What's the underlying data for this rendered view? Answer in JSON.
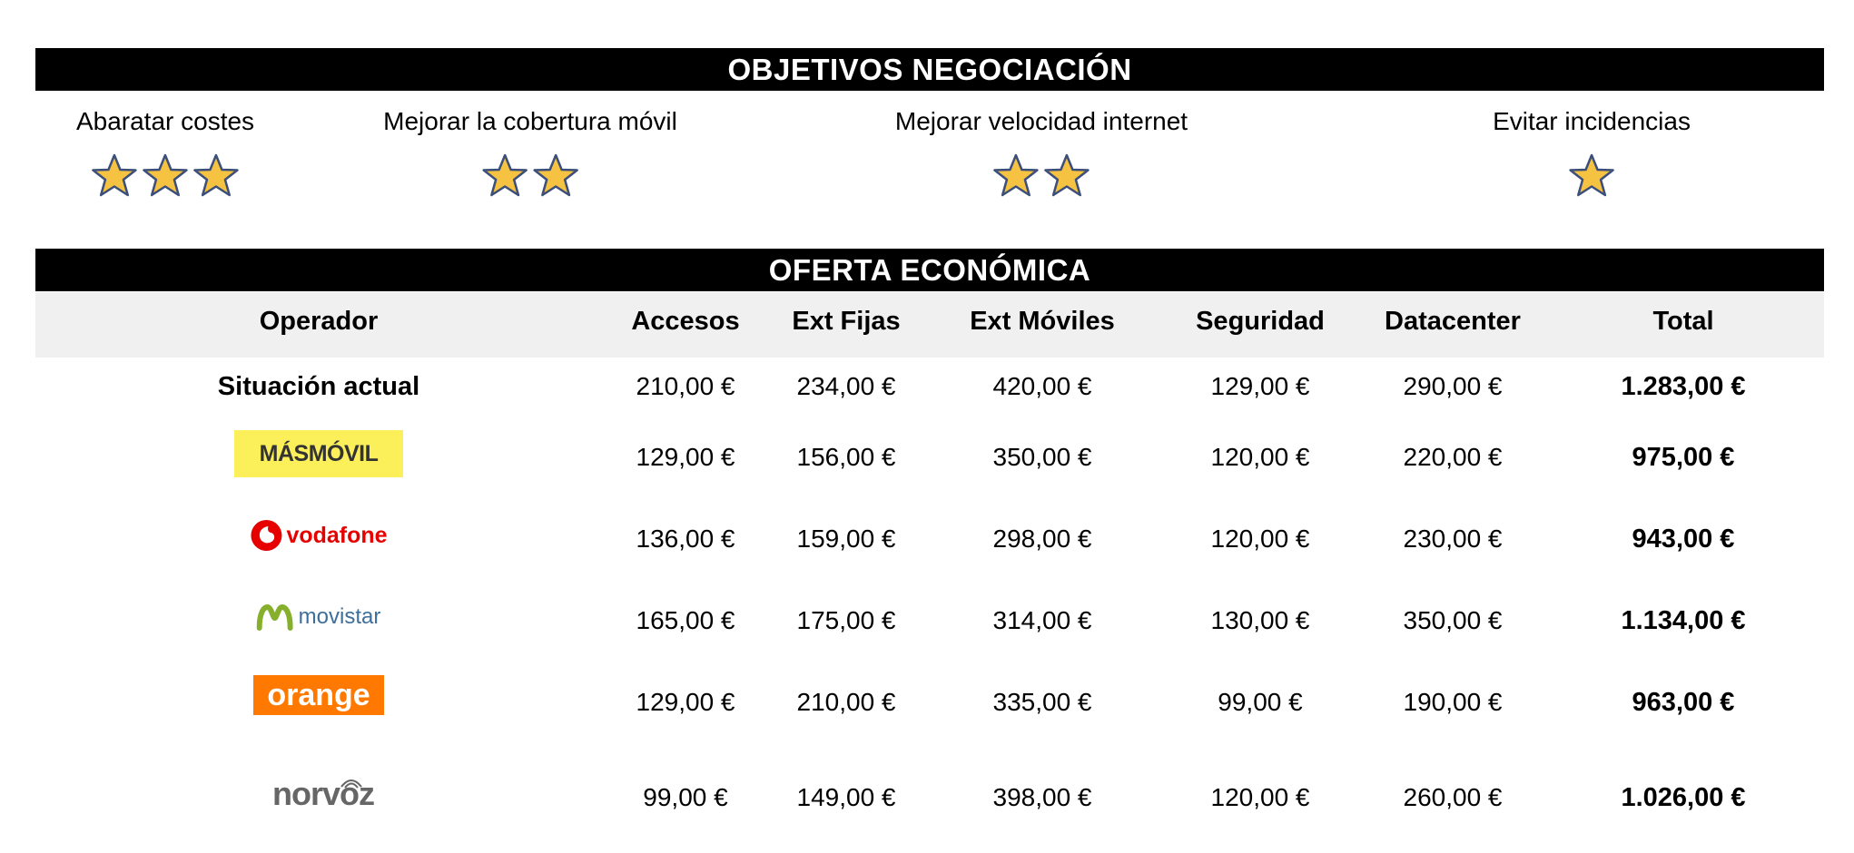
{
  "sections": {
    "objetivos_title": "OBJETIVOS NEGOCIACIÓN",
    "oferta_title": "OFERTA ECONÓMICA"
  },
  "objetivos": [
    {
      "label": "Abaratar costes",
      "stars": 3
    },
    {
      "label": "Mejorar la cobertura móvil",
      "stars": 2
    },
    {
      "label": "Mejorar velocidad internet",
      "stars": 2
    },
    {
      "label": "Evitar incidencias",
      "stars": 1
    }
  ],
  "star_colors": {
    "fill": "#F5C242",
    "stroke": "#3B4F7A"
  },
  "table": {
    "headers": [
      "Operador",
      "Accesos",
      "Ext Fijas",
      "Ext Móviles",
      "Seguridad",
      "Datacenter",
      "Total"
    ],
    "rows": [
      {
        "operator": "Situación actual",
        "logo": "",
        "values": [
          "210,00 €",
          "234,00 €",
          "420,00 €",
          "129,00 €",
          "290,00 €"
        ],
        "total": "1.283,00 €"
      },
      {
        "operator": "MÁSMÓVIL",
        "logo": "masmovil-logo",
        "values": [
          "129,00 €",
          "156,00 €",
          "350,00 €",
          "120,00 €",
          "220,00 €"
        ],
        "total": "975,00 €"
      },
      {
        "operator": "vodafone",
        "logo": "vodafone-logo",
        "values": [
          "136,00 €",
          "159,00 €",
          "298,00 €",
          "120,00 €",
          "230,00 €"
        ],
        "total": "943,00 €"
      },
      {
        "operator": "movistar",
        "logo": "movistar-logo",
        "values": [
          "165,00 €",
          "175,00 €",
          "314,00 €",
          "130,00 €",
          "350,00 €"
        ],
        "total": "1.134,00 €"
      },
      {
        "operator": "orange",
        "logo": "orange-logo",
        "values": [
          "129,00 €",
          "210,00 €",
          "335,00 €",
          "99,00 €",
          "190,00 €"
        ],
        "total": "963,00 €"
      },
      {
        "operator": "norvoz",
        "logo": "norvoz-logo",
        "values": [
          "99,00 €",
          "149,00 €",
          "398,00 €",
          "120,00 €",
          "260,00 €"
        ],
        "total": "1.026,00 €"
      }
    ]
  },
  "brand_colors": {
    "masmovil_bg": "#FBEF5A",
    "vodafone": "#E60000",
    "movistar_green": "#86B02C",
    "movistar_text": "#3E6E9A",
    "orange": "#FF7900",
    "norvoz": "#666666"
  }
}
